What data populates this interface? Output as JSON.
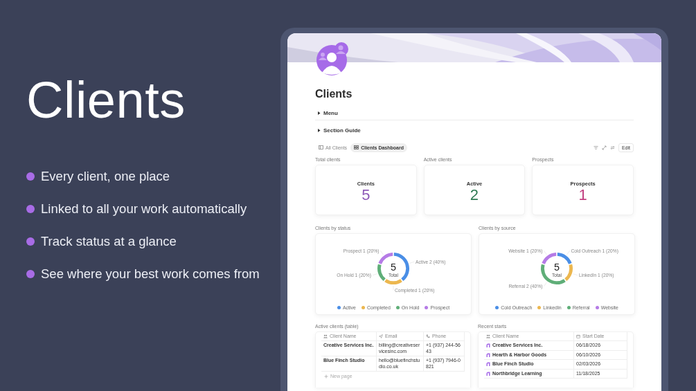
{
  "promo": {
    "title": "Clients",
    "bullets": [
      "Every client, one place",
      "Linked to all your work automatically",
      "Track status at a glance",
      "See where your best work comes from"
    ]
  },
  "page": {
    "title": "Clients",
    "toggles": [
      {
        "label": "Menu",
        "expanded": false
      },
      {
        "label": "Section Guide",
        "expanded": false
      }
    ],
    "views": [
      {
        "label": "All Clients",
        "kind": "table",
        "selected": false
      },
      {
        "label": "Clients Dashboard",
        "kind": "dashboard",
        "selected": true
      }
    ],
    "edit_button": "Edit",
    "stats": [
      {
        "caption": "Total clients",
        "label": "Clients",
        "value": "5",
        "color": "#8f5bb8"
      },
      {
        "caption": "Active clients",
        "label": "Active",
        "value": "2",
        "color": "#2e7a53"
      },
      {
        "caption": "Prospects",
        "label": "Prospects",
        "value": "1",
        "color": "#c23f80"
      }
    ],
    "charts": [
      {
        "caption": "Clients by status",
        "center_value": "5",
        "center_label": "Total",
        "legend": [
          {
            "color": "#4a8ee6"
          },
          {
            "color": "#ecb74f"
          },
          {
            "color": "#5fae78"
          },
          {
            "color": "#b57be6"
          }
        ],
        "chart_data": {
          "type": "donut",
          "categories": [
            "Active",
            "Completed",
            "On Hold",
            "Prospect"
          ],
          "values": [
            2,
            1,
            1,
            1
          ],
          "value_labels": [
            "Active 2 (40%)",
            "Completed 1 (20%)",
            "On Hold 1 (20%)",
            "Prospect 1 (20%)"
          ]
        }
      },
      {
        "caption": "Clients by source",
        "center_value": "5",
        "center_label": "Total",
        "legend": [
          {
            "color": "#4a8ee6"
          },
          {
            "color": "#ecb74f"
          },
          {
            "color": "#5fae78"
          },
          {
            "color": "#b57be6"
          }
        ],
        "chart_data": {
          "type": "donut",
          "categories": [
            "Cold Outreach",
            "LinkedIn",
            "Referral",
            "Website"
          ],
          "values": [
            1,
            1,
            2,
            1
          ],
          "value_labels": [
            "Cold Outreach 1 (20%)",
            "LinkedIn 1 (20%)",
            "Referral 2 (40%)",
            "Website 1 (20%)"
          ]
        }
      }
    ],
    "active_table": {
      "caption": "Active clients (table)",
      "columns": [
        "Client Name",
        "Email",
        "Phone"
      ],
      "rows": [
        [
          "Creative Services Inc.",
          "billing@creativeservicesinc.com",
          "+1 (937) 244-5643"
        ],
        [
          "Blue Finch Studio",
          "hello@bluefinchstudio.co.uk",
          "+1 (937) 7946-0821"
        ]
      ],
      "new_row": "New page"
    },
    "recent_table": {
      "caption": "Recent starts",
      "columns": [
        "Client Name",
        "Start Date"
      ],
      "rows": [
        [
          "Creative Services Inc.",
          "06/18/2026"
        ],
        [
          "Hearth & Harbor Goods",
          "06/10/2026"
        ],
        [
          "Blue Finch Studio",
          "02/03/2026"
        ],
        [
          "Northbridge Learning",
          "11/18/2025"
        ]
      ]
    }
  }
}
